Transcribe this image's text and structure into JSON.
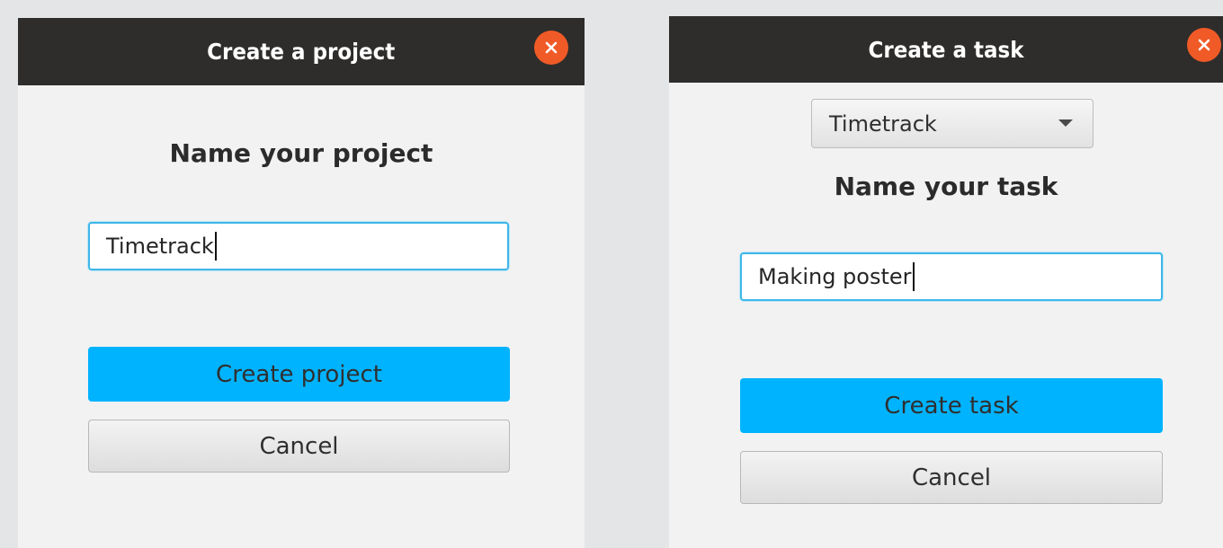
{
  "colors": {
    "desktop_background": "#e4e5e7",
    "titlebar": "#2e2d2b",
    "close_button": "#f05a27",
    "primary_button": "#00b3ff",
    "input_focus_border": "#3fb7e8",
    "dialog_background": "#f2f2f2"
  },
  "project_dialog": {
    "title": "Create a project",
    "close_icon": "close-icon",
    "heading": "Name your project",
    "name_input_value": "Timetrack",
    "create_label": "Create project",
    "cancel_label": "Cancel"
  },
  "task_dialog": {
    "title": "Create a task",
    "close_icon": "close-icon",
    "project_select_value": "Timetrack",
    "dropdown_icon": "chevron-down-icon",
    "heading": "Name your task",
    "name_input_value": "Making poster",
    "create_label": "Create task",
    "cancel_label": "Cancel"
  }
}
